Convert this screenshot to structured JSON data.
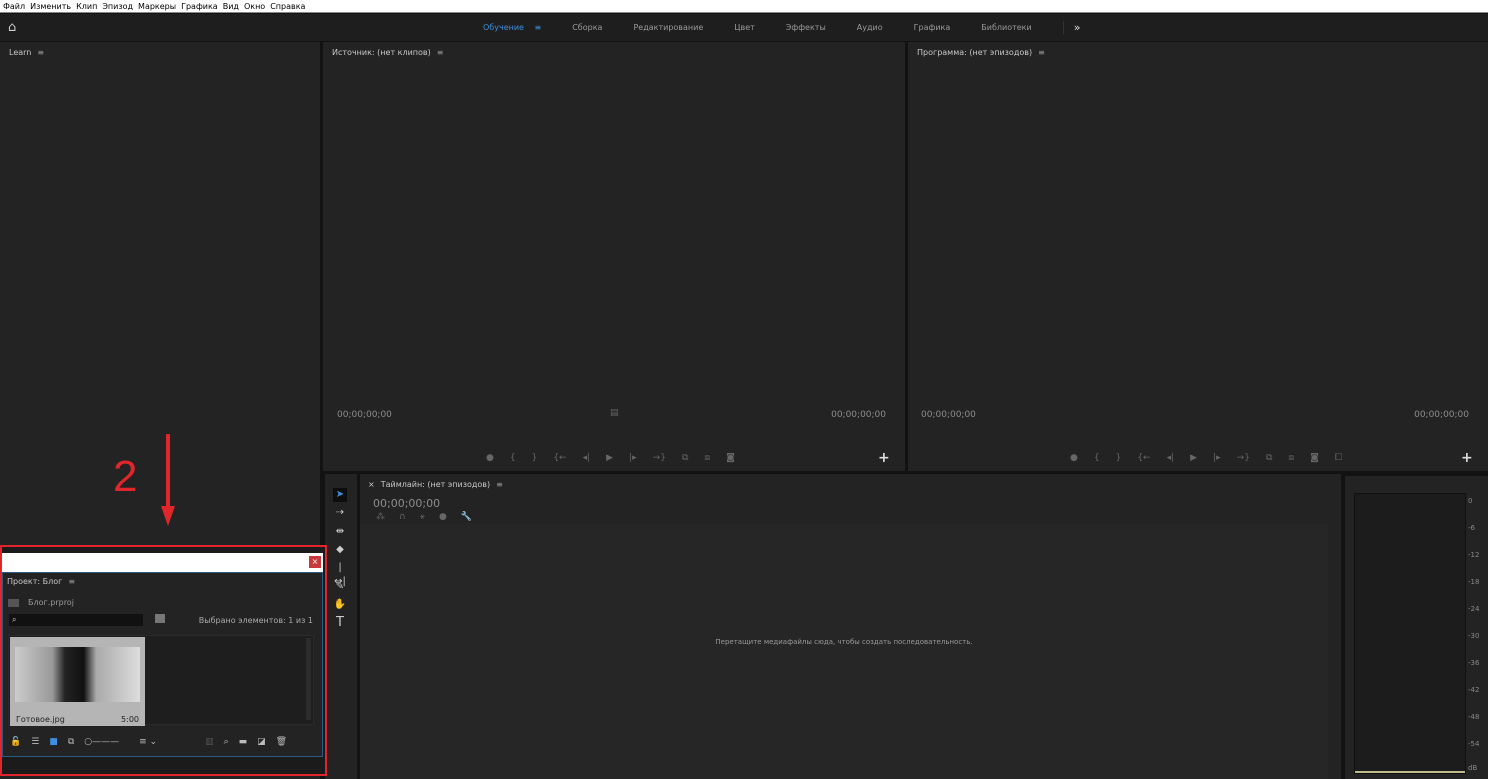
{
  "menu": [
    "Файл",
    "Изменить",
    "Клип",
    "Эпизод",
    "Маркеры",
    "Графика",
    "Вид",
    "Окно",
    "Справка"
  ],
  "workspaces": [
    "Обучение",
    "Сборка",
    "Редактирование",
    "Цвет",
    "Эффекты",
    "Аудио",
    "Графика",
    "Библиотеки"
  ],
  "overflow": "»",
  "learn": {
    "title": "Learn"
  },
  "source": {
    "title": "Источник: (нет клипов)",
    "tc_in": "00;00;00;00",
    "tc_out": "00;00;00;00"
  },
  "program": {
    "title": "Программа: (нет эпизодов)",
    "tc_in": "00;00;00;00",
    "tc_out": "00;00;00;00"
  },
  "timeline": {
    "title": "Таймлайн: (нет эпизодов)",
    "tc": "00;00;00;00",
    "empty": "Перетащите медиафайлы сюда, чтобы создать последовательность."
  },
  "meter": {
    "scale": [
      "0",
      "-6",
      "-12",
      "-18",
      "-24",
      "-30",
      "-36",
      "-42",
      "-48",
      "-54",
      "dB"
    ]
  },
  "project": {
    "title": "Проект: Блог",
    "file": "Блог.prproj",
    "selected": "Выбрано элементов: 1 из 1",
    "search_placeholder": "",
    "clip": {
      "name": "Готовое.jpg",
      "duration": "5:00"
    }
  },
  "annotation": {
    "number": "2"
  },
  "colors": {
    "accent": "#3f8fe0",
    "annotation": "#e0262a"
  }
}
